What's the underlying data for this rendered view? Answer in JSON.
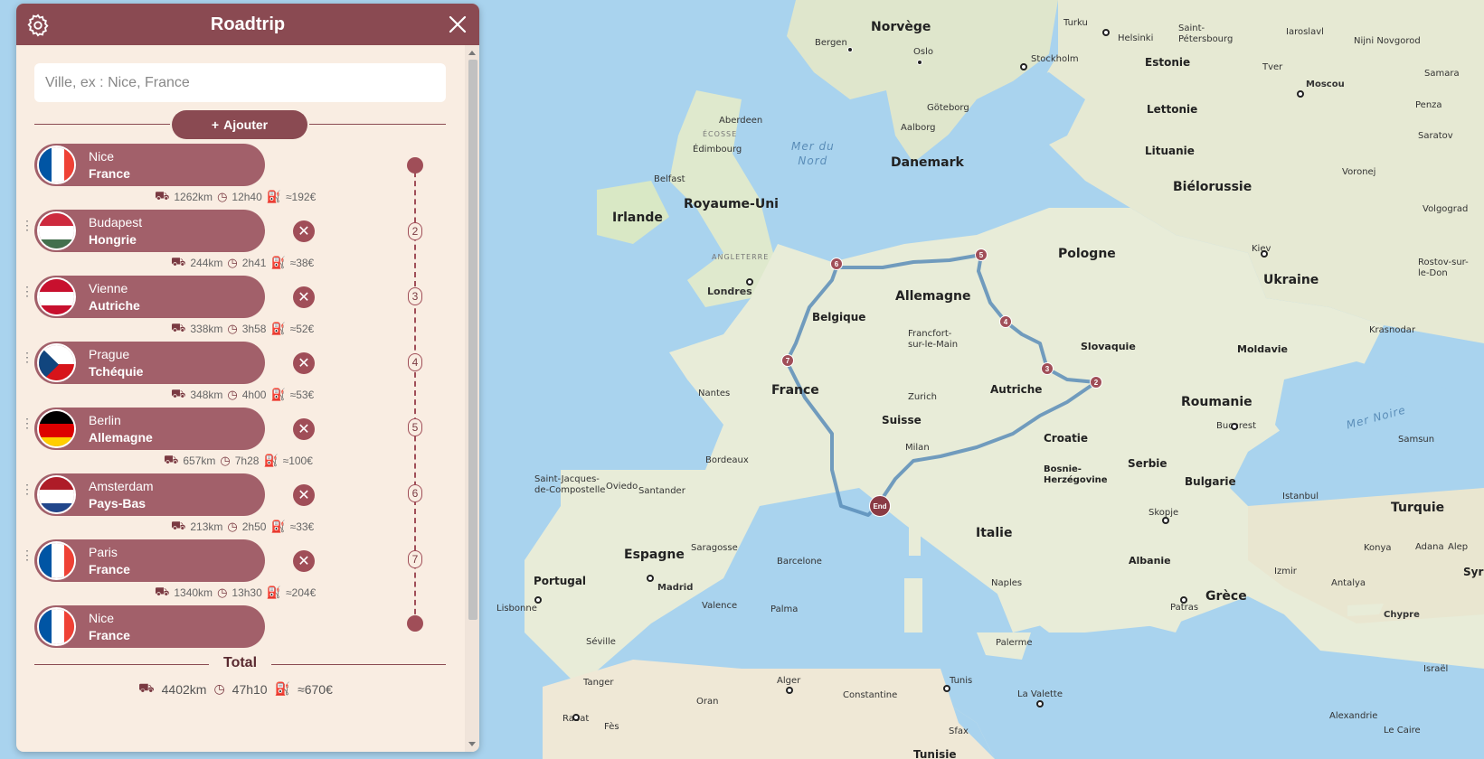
{
  "panel": {
    "title": "Roadtrip",
    "search_placeholder": "Ville, ex : Nice, France",
    "add_label": "Ajouter",
    "total_label": "Total",
    "total": {
      "distance": "4402km",
      "duration": "47h10",
      "cost": "≈670€"
    }
  },
  "stops": [
    {
      "city": "Nice",
      "country": "France",
      "flag": "fr"
    },
    {
      "city": "Budapest",
      "country": "Hongrie",
      "flag": "hu",
      "number": "2"
    },
    {
      "city": "Vienne",
      "country": "Autriche",
      "flag": "at",
      "number": "3"
    },
    {
      "city": "Prague",
      "country": "Tchéquie",
      "flag": "cz",
      "number": "4"
    },
    {
      "city": "Berlin",
      "country": "Allemagne",
      "flag": "de",
      "number": "5"
    },
    {
      "city": "Amsterdam",
      "country": "Pays-Bas",
      "flag": "nl",
      "number": "6"
    },
    {
      "city": "Paris",
      "country": "France",
      "flag": "fr",
      "number": "7"
    },
    {
      "city": "Nice",
      "country": "France",
      "flag": "fr"
    }
  ],
  "legs": [
    {
      "distance": "1262km",
      "duration": "12h40",
      "cost": "≈192€"
    },
    {
      "distance": "244km",
      "duration": "2h41",
      "cost": "≈38€"
    },
    {
      "distance": "338km",
      "duration": "3h58",
      "cost": "≈52€"
    },
    {
      "distance": "348km",
      "duration": "4h00",
      "cost": "≈53€"
    },
    {
      "distance": "657km",
      "duration": "7h28",
      "cost": "≈100€"
    },
    {
      "distance": "213km",
      "duration": "2h50",
      "cost": "≈33€"
    },
    {
      "distance": "1340km",
      "duration": "13h30",
      "cost": "≈204€"
    }
  ],
  "map": {
    "markers": {
      "m2": "2",
      "m3": "3",
      "m4": "4",
      "m5": "5",
      "m6": "6",
      "m7": "7",
      "end": "End"
    },
    "countries": {
      "norvege": "Norvège",
      "estonie": "Estonie",
      "lettonie": "Lettonie",
      "lituanie": "Lituanie",
      "danemark": "Danemark",
      "royaume_uni": "Royaume-Uni",
      "irlande": "Irlande",
      "pologne": "Pologne",
      "bielorussie": "Biélorussie",
      "ukraine": "Ukraine",
      "allemagne": "Allemagne",
      "belgique": "Belgique",
      "france": "France",
      "suisse": "Suisse",
      "autriche": "Autriche",
      "slovaquie": "Slovaquie",
      "moldavie": "Moldavie",
      "roumanie": "Roumanie",
      "croatie": "Croatie",
      "serbie": "Serbie",
      "bosnie": "Bosnie-\nHerzégovine",
      "bulgarie": "Bulgarie",
      "italie": "Italie",
      "espagne": "Espagne",
      "portugal": "Portugal",
      "turquie": "Turquie",
      "grece": "Grèce",
      "albanie": "Albanie"
    },
    "cities": {
      "bergen": "Bergen",
      "oslo": "Oslo",
      "stockholm": "Stockholm",
      "turku": "Turku",
      "helsinki": "Helsinki",
      "saint_petersbourg": "Saint-\nPétersbourg",
      "iaroslavl": "Iaroslavl",
      "nijni": "Nijni Novgorod",
      "tver": "Tver",
      "moscou": "Moscou",
      "samara": "Samara",
      "penza": "Penza",
      "saratov": "Saratov",
      "voronej": "Voronej",
      "volgograd": "Volgograd",
      "rostov": "Rostov-sur-\nle-Don",
      "kiev": "Kiev",
      "krasnodar": "Krasnodar",
      "aberdeen": "Aberdeen",
      "edimbourg": "Édimbourg",
      "belfast": "Belfast",
      "goteborg": "Göteborg",
      "aalborg": "Aalborg",
      "londres": "Londres",
      "francfort": "Francfort-\nsur-le-Main",
      "nantes": "Nantes",
      "zurich": "Zurich",
      "milan": "Milan",
      "bordeaux": "Bordeaux",
      "saint_jacques": "Saint-Jacques-\nde-Compostelle",
      "oviedo": "Oviedo",
      "santander": "Santander",
      "saragosse": "Saragosse",
      "barcelone": "Barcelone",
      "madrid": "Madrid",
      "valence": "Valence",
      "lisbonne": "Lisbonne",
      "seville": "Séville",
      "palma": "Palma",
      "tanger": "Tanger",
      "alger": "Alger",
      "tunis": "Tunis",
      "constantine": "Constantine",
      "rabat": "Rabat",
      "oran": "Oran",
      "fes": "Fès",
      "naples": "Naples",
      "palerme": "Palerme",
      "la_valette": "La Valette",
      "sfax": "Sfax",
      "tunisie": "Tunisie",
      "bucarest": "Bucarest",
      "samsun": "Samsun",
      "istanbul": "Istanbul",
      "skopje": "Skopje",
      "izmir": "Izmir",
      "konya": "Konya",
      "adana": "Adana",
      "alep": "Alep",
      "antalya": "Antalya",
      "patras": "Patras",
      "chypre": "Chypre",
      "israel": "Israël",
      "alexandrie": "Alexandrie",
      "le_caire": "Le Caire",
      "syrie": "Syri"
    },
    "seas": {
      "mer_du_nord": "Mer du\nNord",
      "mer_noire": "Mer Noire"
    },
    "regions": {
      "ecosse": "ÉCOSSE",
      "angleterre": "ANGLETERRE"
    },
    "colors": {
      "land": "#e8ecd8",
      "water": "#a9d3ee",
      "route": "#5b8db8",
      "accent": "#8a4a52"
    }
  }
}
